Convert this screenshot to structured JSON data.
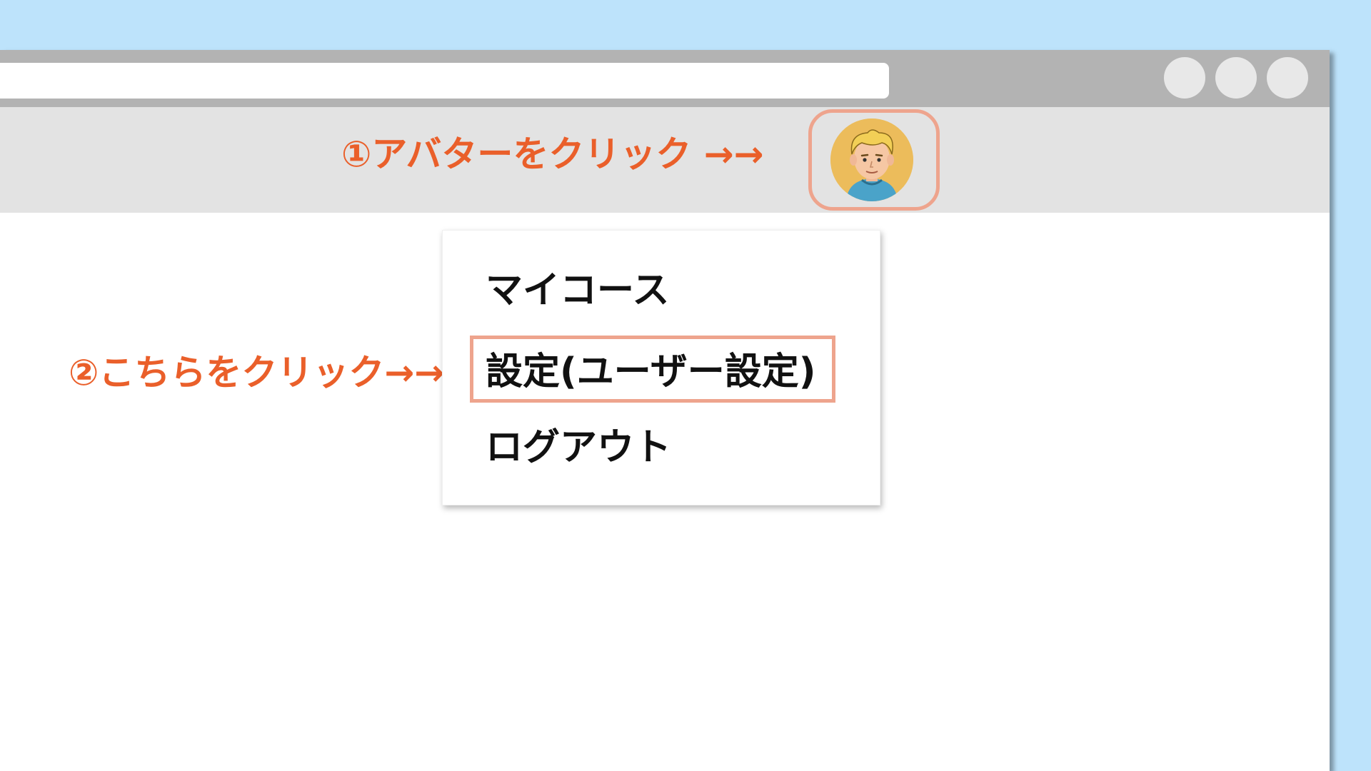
{
  "annotations": {
    "step1": "①アバターをクリック →→",
    "step2": "②こちらをクリック→→"
  },
  "header": {
    "avatar_icon": "user-avatar-icon"
  },
  "menu": {
    "items": [
      {
        "label": "マイコース"
      },
      {
        "label": "設定(ユーザー設定)"
      },
      {
        "label": "ログアウト"
      }
    ]
  },
  "colors": {
    "background": "#bde3fb",
    "annotation": "#ea5f2a",
    "highlight": "#eea48d",
    "titlebar": "#b3b3b3",
    "header": "#e3e3e3"
  }
}
